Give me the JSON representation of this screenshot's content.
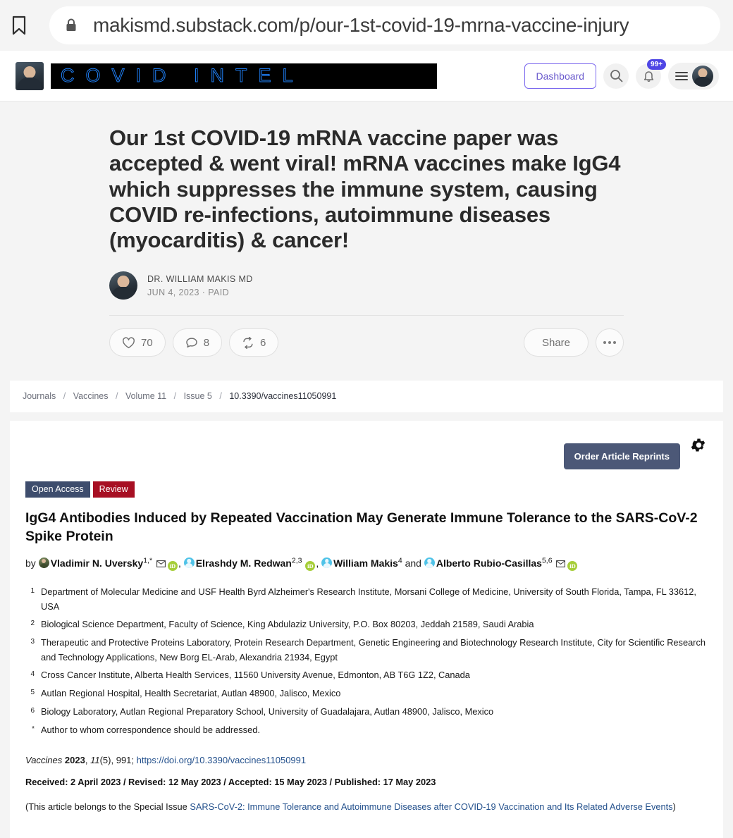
{
  "browser": {
    "url": "makismd.substack.com/p/our-1st-covid-19-mrna-vaccine-injury",
    "bookmark_icon": "bookmark-icon",
    "lock_icon": "padlock-icon"
  },
  "substack_header": {
    "publication_name": "COVID INTEL",
    "dashboard_label": "Dashboard",
    "search_icon": "search-icon",
    "bell_icon": "bell-icon",
    "notification_count": "99+",
    "menu_icon": "hamburger-menu-icon",
    "avatar": "user-avatar"
  },
  "post": {
    "title": "Our 1st COVID-19 mRNA vaccine paper was accepted & went viral! mRNA vaccines make IgG4 which suppresses the immune system, causing COVID re-infections, autoimmune diseases (myocarditis) & cancer!",
    "author_name": "DR. WILLIAM MAKIS MD",
    "meta": "JUN 4, 2023 · PAID",
    "actions": {
      "like_count": "70",
      "comment_count": "8",
      "restack_count": "6",
      "share_label": "Share",
      "more_label": "more-options"
    }
  },
  "breadcrumb": {
    "items": [
      "Journals",
      "Vaccines",
      "Volume 11",
      "Issue 5"
    ],
    "current": "10.3390/vaccines11050991",
    "separator": "/"
  },
  "paper": {
    "reprint_button": "Order Article Reprints",
    "gear_icon": "gear-settings-icon",
    "badges": [
      {
        "label": "Open Access",
        "color": "#3e4d6d"
      },
      {
        "label": "Review",
        "color": "#a70f23"
      }
    ],
    "title": "IgG4 Antibodies Induced by Repeated Vaccination May Generate Immune Tolerance to the SARS-CoV-2 Spike Protein",
    "by_label": "by",
    "and_label": "and",
    "authors": [
      {
        "name": "Vladimir N. Uversky",
        "sup": "1,*",
        "avatar": "author-photo-avatar",
        "has_mail": true,
        "has_orcid": true
      },
      {
        "name": "Elrashdy M. Redwan",
        "sup": "2,3",
        "avatar": "author-generic-avatar",
        "has_mail": false,
        "has_orcid": true
      },
      {
        "name": "William Makis",
        "sup": "4",
        "avatar": "author-generic-avatar",
        "has_mail": false,
        "has_orcid": false
      },
      {
        "name": "Alberto Rubio-Casillas",
        "sup": "5,6",
        "avatar": "author-generic-avatar",
        "has_mail": true,
        "has_orcid": true
      }
    ],
    "affiliations": [
      {
        "num": "1",
        "text": "Department of Molecular Medicine and USF Health Byrd Alzheimer's Research Institute, Morsani College of Medicine, University of South Florida, Tampa, FL 33612, USA"
      },
      {
        "num": "2",
        "text": "Biological Science Department, Faculty of Science, King Abdulaziz University, P.O. Box 80203, Jeddah 21589, Saudi Arabia"
      },
      {
        "num": "3",
        "text": "Therapeutic and Protective Proteins Laboratory, Protein Research Department, Genetic Engineering and Biotechnology Research Institute, City for Scientific Research and Technology Applications, New Borg EL-Arab, Alexandria 21934, Egypt"
      },
      {
        "num": "4",
        "text": "Cross Cancer Institute, Alberta Health Services, 11560 University Avenue, Edmonton, AB T6G 1Z2, Canada"
      },
      {
        "num": "5",
        "text": "Autlan Regional Hospital, Health Secretariat, Autlan 48900, Jalisco, Mexico"
      },
      {
        "num": "6",
        "text": "Biology Laboratory, Autlan Regional Preparatory School, University of Guadalajara, Autlan 48900, Jalisco, Mexico"
      },
      {
        "num": "*",
        "text": "Author to whom correspondence should be addressed."
      }
    ],
    "citation": {
      "journal": "Vaccines",
      "year": "2023",
      "volume": "11",
      "issue": "(5)",
      "article_number": "991",
      "doi_url": "https://doi.org/10.3390/vaccines11050991"
    },
    "dates_line": "Received: 2 April 2023 / Revised: 12 May 2023 / Accepted: 15 May 2023 / Published: 17 May 2023",
    "special_issue_prefix": "(This article belongs to the Special Issue ",
    "special_issue_link": "SARS-CoV-2: Immune Tolerance and Autoimmune Diseases after COVID-19 Vaccination and Its Related Adverse Events",
    "special_issue_suffix": ")"
  }
}
